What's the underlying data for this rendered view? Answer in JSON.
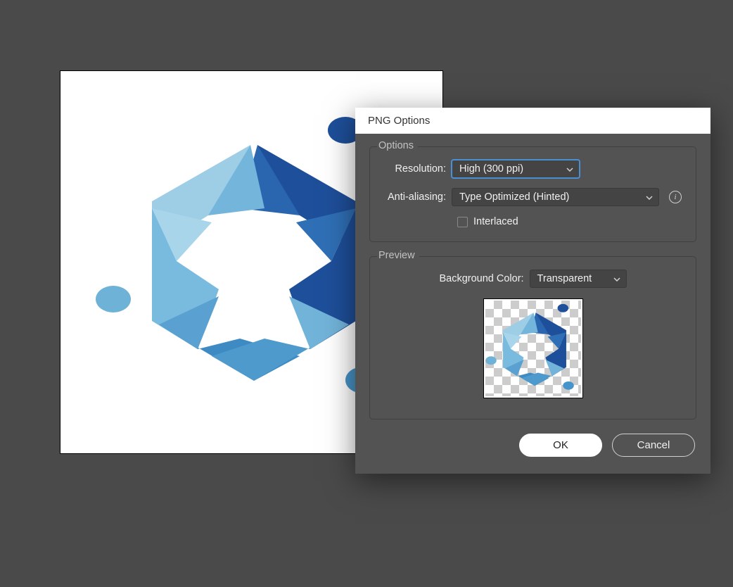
{
  "dialog": {
    "title": "PNG Options",
    "options_section": {
      "legend": "Options",
      "resolution_label": "Resolution:",
      "resolution_value": "High (300 ppi)",
      "antialias_label": "Anti-aliasing:",
      "antialias_value": "Type Optimized (Hinted)",
      "interlaced_label": "Interlaced",
      "interlaced_checked": false
    },
    "preview_section": {
      "legend": "Preview",
      "bgcolor_label": "Background Color:",
      "bgcolor_value": "Transparent"
    },
    "buttons": {
      "ok": "OK",
      "cancel": "Cancel"
    }
  },
  "colors": {
    "logo_light": "#84c0e1",
    "logo_mid": "#3e8bc4",
    "logo_dark": "#1e4f9a"
  }
}
